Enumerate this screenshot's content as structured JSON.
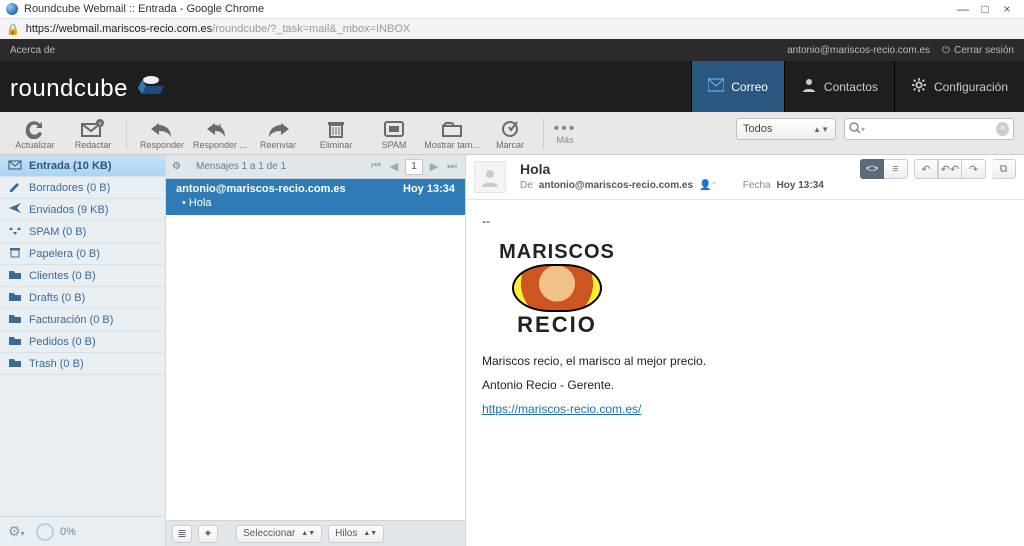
{
  "window": {
    "title": "Roundcube Webmail :: Entrada - Google Chrome",
    "minimize": "—",
    "maximize": "□",
    "close": "×"
  },
  "address": {
    "host": "https://webmail.mariscos-recio.com.es",
    "path": "/roundcube/?_task=mail&_mbox=INBOX"
  },
  "topbar": {
    "about": "Acerca de",
    "user": "antonio@mariscos-recio.com.es",
    "logout": "Cerrar sesión"
  },
  "logo": {
    "part1": "round",
    "part2": "cube"
  },
  "tabs": {
    "mail": "Correo",
    "contacts": "Contactos",
    "settings": "Configuración"
  },
  "toolbar": {
    "refresh": "Actualizar",
    "compose": "Redactar",
    "reply": "Responder",
    "replyall": "Responder ...",
    "forward": "Reenviar",
    "delete": "Eliminar",
    "spam": "SPAM",
    "show": "Mostrar tam...",
    "mark": "Marcar",
    "more": "Más"
  },
  "scope": {
    "value": "Todos"
  },
  "search": {
    "placeholder": ""
  },
  "folders": [
    {
      "label": "Entrada (10 KB)",
      "icon": "inbox",
      "selected": true
    },
    {
      "label": "Borradores (0 B)",
      "icon": "pencil"
    },
    {
      "label": "Enviados (9 KB)",
      "icon": "sent"
    },
    {
      "label": "SPAM (0 B)",
      "icon": "recycle"
    },
    {
      "label": "Papelera (0 B)",
      "icon": "trash"
    },
    {
      "label": "Clientes (0 B)",
      "icon": "folder"
    },
    {
      "label": "Drafts (0 B)",
      "icon": "folder"
    },
    {
      "label": "Facturación (0 B)",
      "icon": "folder"
    },
    {
      "label": "Pedidos (0 B)",
      "icon": "folder"
    },
    {
      "label": "Trash (0 B)",
      "icon": "folder"
    }
  ],
  "quota": "0%",
  "list": {
    "header": "Mensajes 1 a 1 de 1",
    "page": "1",
    "select_label": "Seleccionar",
    "threads_label": "Hilos"
  },
  "message": {
    "from": "antonio@mariscos-recio.com.es",
    "date": "Hoy 13:34",
    "subject": "Hola"
  },
  "preview": {
    "subject": "Hola",
    "from_label": "De",
    "from": "antonio@mariscos-recio.com.es",
    "date_label": "Fecha",
    "date": "Hoy 13:34",
    "sep": "--",
    "logo_top": "MARISCOS",
    "logo_bottom": "RECIO",
    "line1": "Mariscos recio, el marisco al mejor precio.",
    "line2": "Antonio Recio - Gerente.",
    "link": "https://mariscos-recio.com.es/"
  }
}
